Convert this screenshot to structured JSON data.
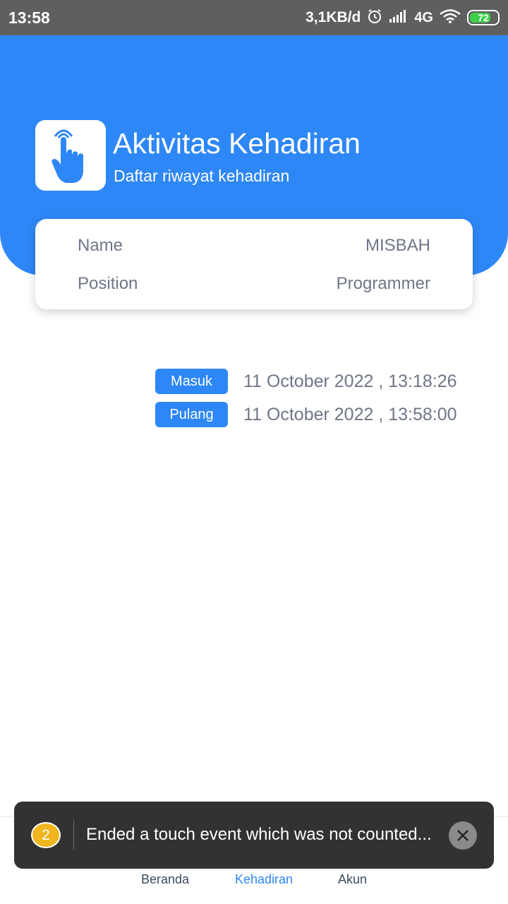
{
  "status_bar": {
    "time": "13:58",
    "network_speed": "3,1KB/d",
    "network_type": "4G",
    "battery": "72",
    "icons": [
      "alarm-icon",
      "signal-icon",
      "wifi-icon",
      "battery-icon"
    ]
  },
  "header": {
    "title": "Aktivitas Kehadiran",
    "subtitle": "Daftar riwayat kehadiran",
    "icon": "touch-hand-icon",
    "background_color": "#2e87f6"
  },
  "profile": {
    "rows": [
      {
        "label": "Name",
        "value": "MISBAH"
      },
      {
        "label": "Position",
        "value": "Programmer"
      }
    ]
  },
  "attendance": [
    {
      "type": "Masuk",
      "datetime": "11 October 2022 , 13:18:26"
    },
    {
      "type": "Pulang",
      "datetime": "11 October 2022 , 13:58:00"
    }
  ],
  "nav": {
    "items": [
      {
        "label": "Beranda",
        "active": false
      },
      {
        "label": "Kehadiran",
        "active": true
      },
      {
        "label": "Akun",
        "active": false
      }
    ],
    "active_color": "#2e87f6"
  },
  "toast": {
    "count": "2",
    "message": "Ended a touch event which was not counted...",
    "icon": "close-icon"
  }
}
